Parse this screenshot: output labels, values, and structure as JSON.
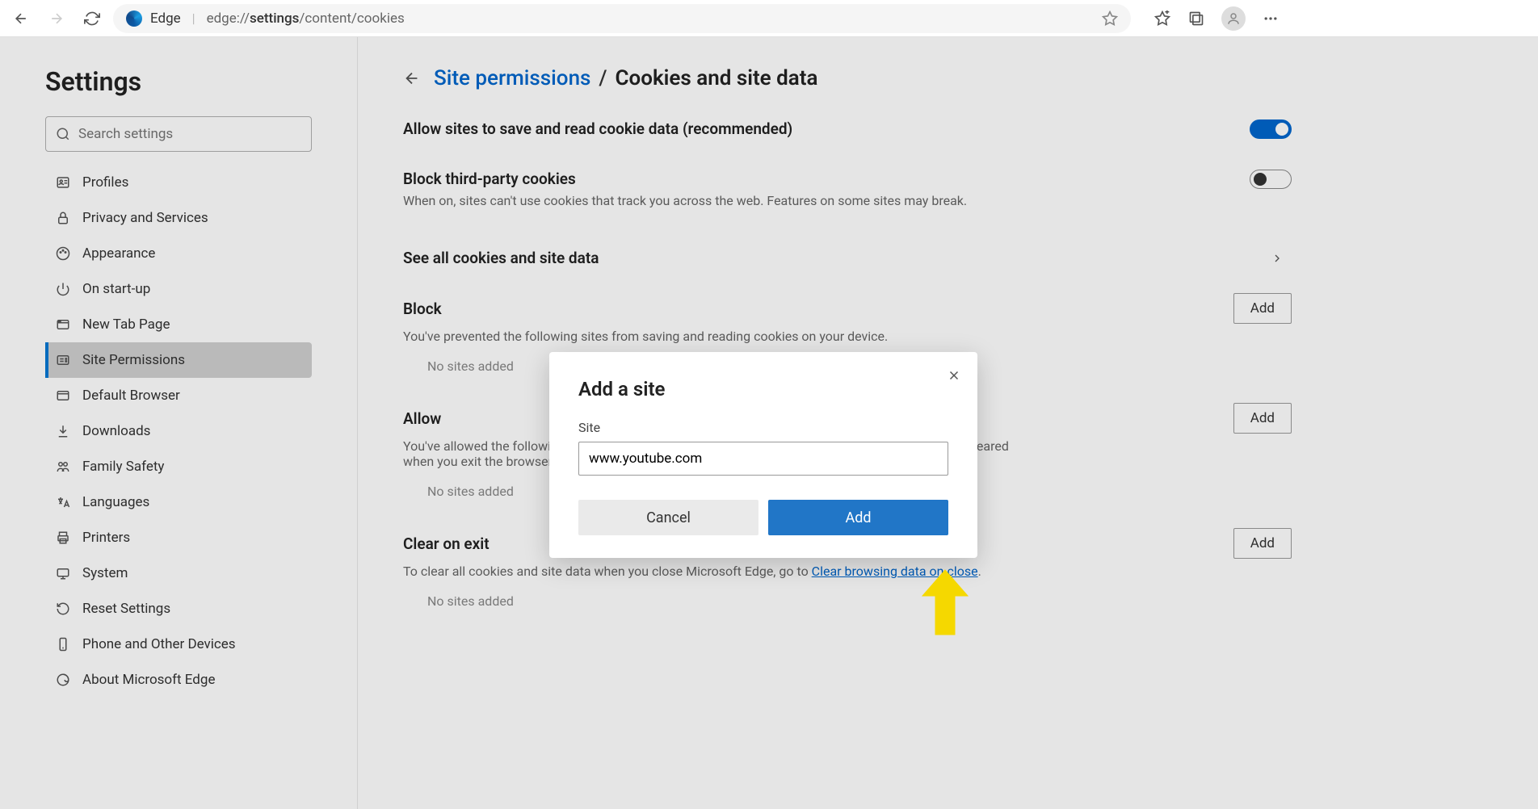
{
  "chrome": {
    "page_label": "Edge",
    "url_prefix": "edge://",
    "url_active": "settings",
    "url_suffix": "/content/cookies"
  },
  "sidebar": {
    "title": "Settings",
    "search_placeholder": "Search settings",
    "items": [
      {
        "label": "Profiles",
        "icon": "profile-icon"
      },
      {
        "label": "Privacy and Services",
        "icon": "lock-icon"
      },
      {
        "label": "Appearance",
        "icon": "palette-icon"
      },
      {
        "label": "On start-up",
        "icon": "power-icon"
      },
      {
        "label": "New Tab Page",
        "icon": "tab-icon"
      },
      {
        "label": "Site Permissions",
        "icon": "permissions-icon"
      },
      {
        "label": "Default Browser",
        "icon": "browser-icon"
      },
      {
        "label": "Downloads",
        "icon": "download-icon"
      },
      {
        "label": "Family Safety",
        "icon": "family-icon"
      },
      {
        "label": "Languages",
        "icon": "languages-icon"
      },
      {
        "label": "Printers",
        "icon": "printer-icon"
      },
      {
        "label": "System",
        "icon": "system-icon"
      },
      {
        "label": "Reset Settings",
        "icon": "reset-icon"
      },
      {
        "label": "Phone and Other Devices",
        "icon": "phone-icon"
      },
      {
        "label": "About Microsoft Edge",
        "icon": "edge-icon"
      }
    ],
    "active_index": 5
  },
  "main": {
    "breadcrumb_link": "Site permissions",
    "breadcrumb_current": "Cookies and site data",
    "allow_cookies": {
      "label": "Allow sites to save and read cookie data (recommended)",
      "on": true
    },
    "block_third": {
      "label": "Block third-party cookies",
      "desc": "When on, sites can't use cookies that track you across the web. Features on some sites may break.",
      "on": false
    },
    "see_all": "See all cookies and site data",
    "block_section": {
      "title": "Block",
      "desc": "You've prevented the following sites from saving and reading cookies on your device.",
      "empty": "No sites added",
      "add": "Add"
    },
    "allow_section": {
      "title": "Allow",
      "desc": "You've allowed the following sites to save cookies on your device. Cookies for these sites won't be cleared when you exit the browser.",
      "empty": "No sites added",
      "add": "Add"
    },
    "clear_section": {
      "title": "Clear on exit",
      "desc_pre": "To clear all cookies and site data when you close Microsoft Edge, go to ",
      "desc_link": "Clear browsing data on close",
      "desc_post": ".",
      "empty": "No sites added",
      "add": "Add"
    }
  },
  "modal": {
    "title": "Add a site",
    "field_label": "Site",
    "field_value": "www.youtube.com",
    "cancel": "Cancel",
    "add": "Add"
  }
}
